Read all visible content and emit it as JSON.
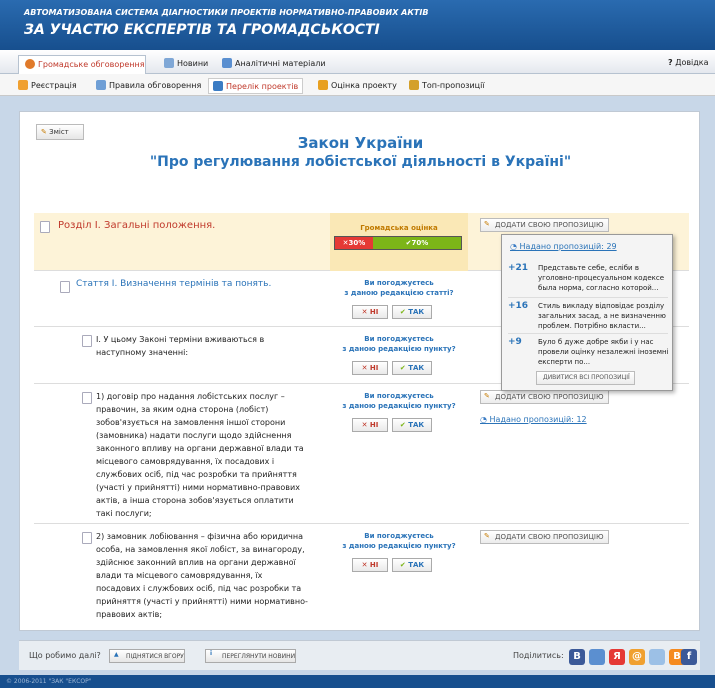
{
  "header": {
    "subtitle": "АВТОМАТИЗОВАНА СИСТЕМА ДІАГНОСТИКИ ПРОЕКТІВ НОРМАТИВНО-ПРАВОВИХ АКТІВ",
    "title": "ЗА УЧАСТЮ ЕКСПЕРТІВ ТА ГРОМАДСЬКОСТІ"
  },
  "nav_main": {
    "tabs": [
      "Громадське обговорення",
      "Новини",
      "Аналітичні матеріали"
    ],
    "help": "Довідка"
  },
  "nav_sub": {
    "tabs": [
      "Реєстрація",
      "Правила обговорення",
      "Перелік проектів",
      "Оцінка проекту",
      "Топ-пропозиції"
    ]
  },
  "content": {
    "zmist": "Зміст",
    "doc_title_line1": "Закон України",
    "doc_title_line2": "\"Про регулювання лобістської діяльності в Україні\"",
    "section": {
      "title": "Розділ I. Загальні положення.",
      "rating_label": "Громадська оцінка",
      "against": "30%",
      "for": "70%",
      "against_fraction": 0.3,
      "add_btn": "ДОДАТИ СВОЮ ПРОПОЗИЦІЮ",
      "proposals": "Надано пропозицій: 29"
    },
    "article": {
      "title": "Стаття I. Визначення термінів та понять.",
      "q": "Ви погоджуєтесь\nз даною редакцією статті?"
    },
    "points": [
      {
        "text": "I. У цьому Законі терміни вживаються в наступному значенні:",
        "q": "Ви погоджуєтесь\nз даною редакцією пункту?"
      },
      {
        "text": "1) договір про надання лобістських послуг – правочин, за яким одна сторона (лобіст) зобов'язується на замовлення іншої сторони (замовника) надати послуги щодо здійснення законного впливу на органи державної влади та місцевого самоврядування, їх посадових і службових осіб, під час розробки та прийняття (участі у прийнятті) ними нормативно-правових актів, а інша сторона зобов'язується оплатити такі послуги;",
        "q": "Ви погоджуєтесь\nз даною редакцією пункту?",
        "add_btn": "ДОДАТИ СВОЮ ПРОПОЗИЦІЮ",
        "proposals": "Надано пропозицій: 12"
      },
      {
        "text": "2) замовник лобіювання – фізична або юридична особа, на замовлення якої лобіст, за винагороду, здійснює законний вплив на органи державної влади та місцевого самоврядування, їх посадових і службових осіб, під час розробки та прийняття (участі у прийнятті) ними нормативно-правових актів;",
        "q": "Ви погоджуєтесь\nз даною редакцією пункту?",
        "add_btn": "ДОДАТИ СВОЮ ПРОПОЗИЦІЮ"
      }
    ],
    "no_label": "НІ",
    "yes_label": "ТАК"
  },
  "popup": {
    "items": [
      {
        "score": "+21",
        "text": "Представьте себе, есліби в уголовно-процесуальном кодексе была норма, согласно которой..."
      },
      {
        "score": "+16",
        "text": "Стиль викладу відповідає розділу загальних засад, а не визначенню проблем. Потрібно вкласти..."
      },
      {
        "score": "+9",
        "text": "Було б дуже добре якби і у нас провели оцінку незалежні іноземні експерти по..."
      }
    ],
    "all_btn": "ДИВИТИСЯ ВСІ ПРОПОЗИЦІЇ"
  },
  "footer": {
    "what_next": "Що робимо далі?",
    "up_btn": "ПІДНЯТИСЯ ВГОРУ",
    "news_btn": "ПЕРЕГЛЯНУТИ НОВИНИ",
    "share": "Поділитись:",
    "social": [
      "B",
      "",
      "Я",
      "@",
      "",
      "B",
      "f"
    ],
    "copyright": "© 2006-2011 \"ЗАК \"ЕКСОР\""
  },
  "colors": {
    "accent": "#2a73b8",
    "header": "#174f8e",
    "no": "#e53935",
    "yes": "#7cb518",
    "section_bg": "#fdf3d8"
  }
}
